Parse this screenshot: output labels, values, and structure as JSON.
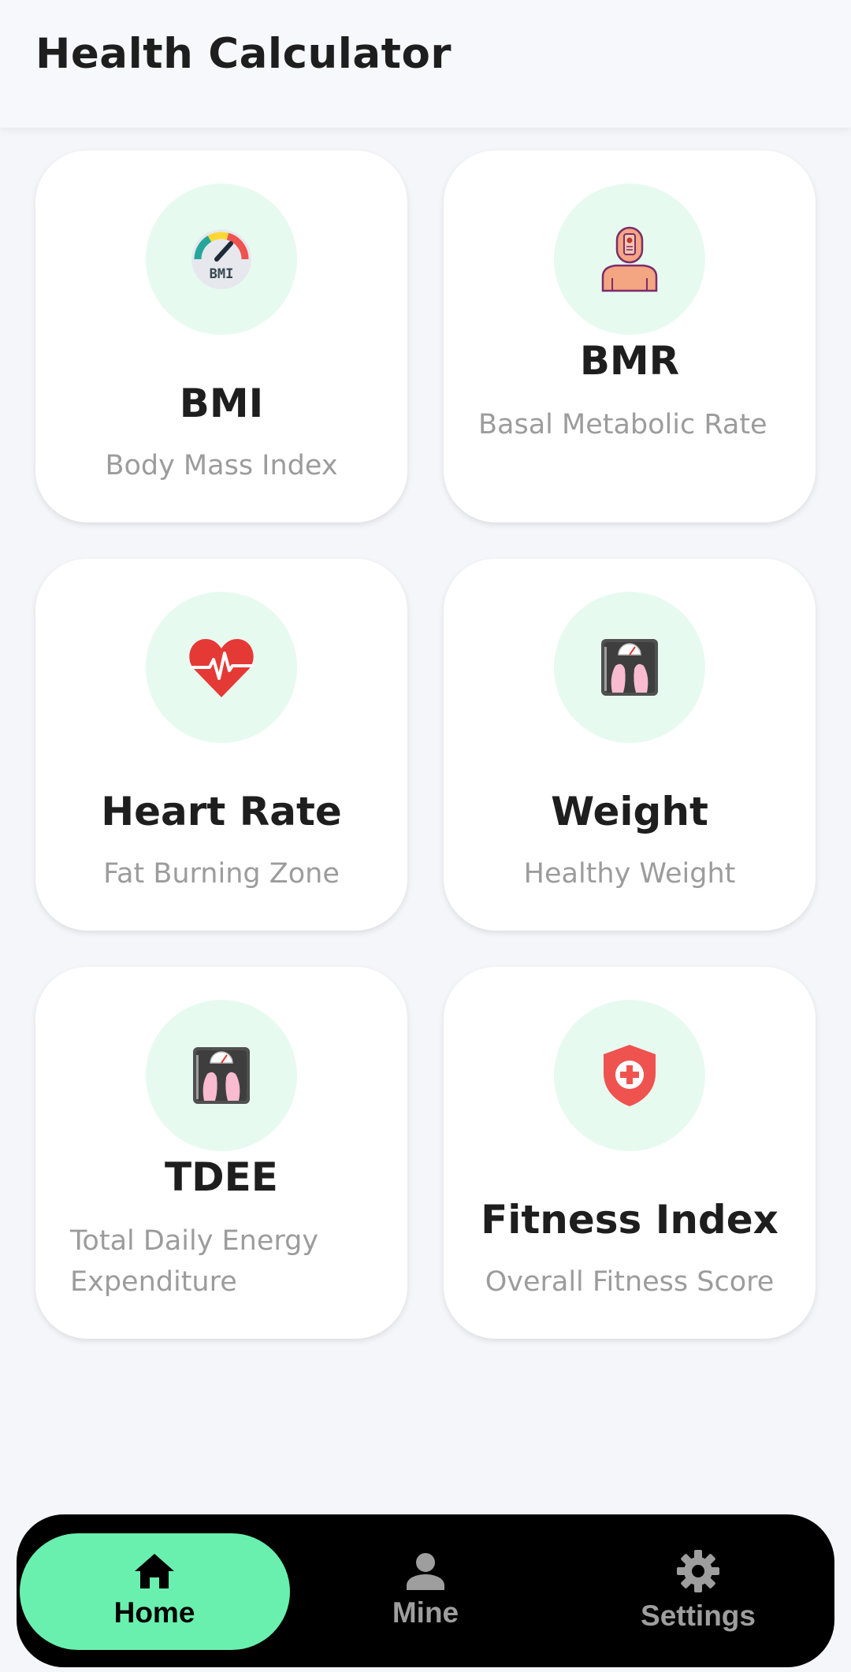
{
  "header": {
    "title": "Health Calculator"
  },
  "cards": [
    {
      "title": "BMI",
      "subtitle": "Body Mass Index",
      "icon": "bmi-gauge-icon"
    },
    {
      "title": "BMR",
      "subtitle": "Basal Metabolic Rate",
      "icon": "body-person-icon"
    },
    {
      "title": "Heart Rate",
      "subtitle": "Fat Burning Zone",
      "icon": "heart-pulse-icon"
    },
    {
      "title": "Weight",
      "subtitle": "Healthy Weight",
      "icon": "scale-icon"
    },
    {
      "title": "TDEE",
      "subtitle": "Total Daily Energy Expenditure",
      "icon": "scale-icon"
    },
    {
      "title": "Fitness Index",
      "subtitle": "Overall Fitness Score",
      "icon": "shield-plus-icon"
    }
  ],
  "bmi_icon_text": "BMI",
  "nav": {
    "items": [
      {
        "label": "Home",
        "icon": "home-icon",
        "active": true
      },
      {
        "label": "Mine",
        "icon": "person-icon",
        "active": false
      },
      {
        "label": "Settings",
        "icon": "gear-icon",
        "active": false
      }
    ]
  },
  "colors": {
    "accent": "#69F0AE",
    "icon_bg": "#E7FAF0",
    "background": "#F5F6FA",
    "nav_bg": "#000000"
  }
}
